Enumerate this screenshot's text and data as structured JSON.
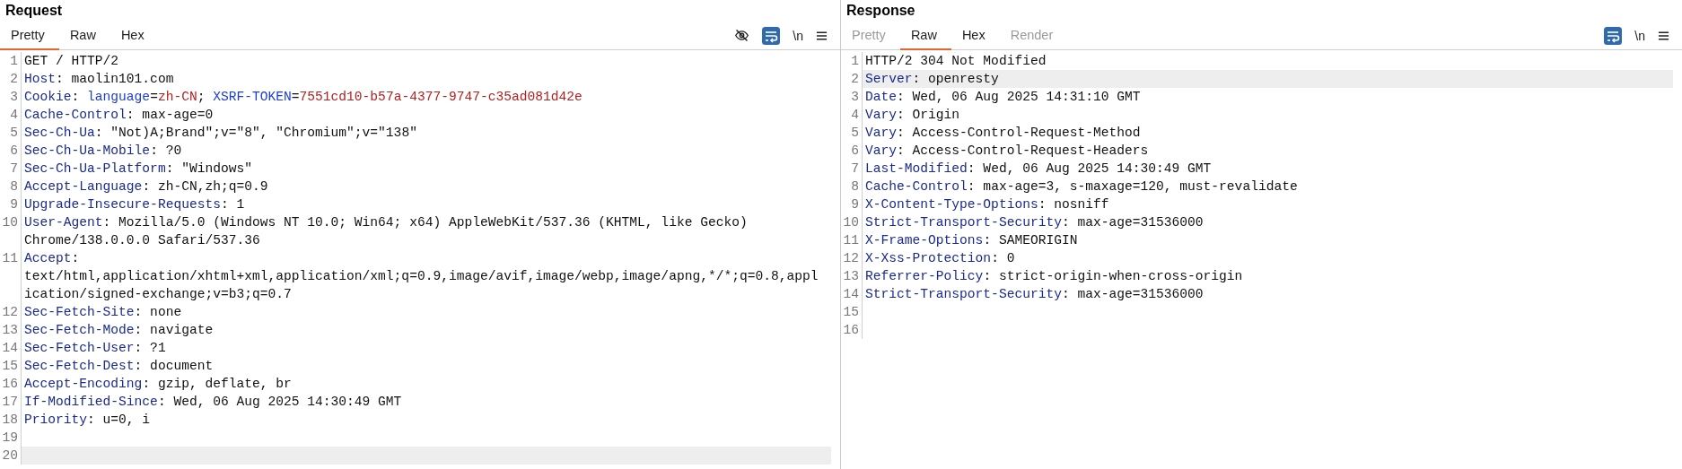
{
  "panes": [
    {
      "title": "Request",
      "tabs": [
        {
          "label": "Pretty",
          "selected": true,
          "disabled": false
        },
        {
          "label": "Raw",
          "selected": false,
          "disabled": false
        },
        {
          "label": "Hex",
          "selected": false,
          "disabled": false
        }
      ],
      "toolbar": [
        {
          "kind": "hide"
        },
        {
          "kind": "wrap",
          "on": true
        },
        {
          "kind": "newline",
          "label": "\\n"
        },
        {
          "kind": "menu"
        }
      ],
      "lines": [
        {
          "n": "1",
          "highlighted": false,
          "parts": [
            {
              "kind": "plain",
              "text": "GET / HTTP/2"
            }
          ]
        },
        {
          "n": "2",
          "highlighted": false,
          "parts": [
            {
              "kind": "key",
              "text": "Host"
            },
            {
              "kind": "plain",
              "text": ": maolin101.com"
            }
          ]
        },
        {
          "n": "3",
          "highlighted": false,
          "parts": [
            {
              "kind": "key",
              "text": "Cookie"
            },
            {
              "kind": "plain",
              "text": ": "
            },
            {
              "kind": "cookie_name",
              "text": "language"
            },
            {
              "kind": "plain",
              "text": "="
            },
            {
              "kind": "cookie_value",
              "text": "zh-CN"
            },
            {
              "kind": "plain",
              "text": "; "
            },
            {
              "kind": "cookie_name",
              "text": "XSRF-TOKEN"
            },
            {
              "kind": "plain",
              "text": "="
            },
            {
              "kind": "cookie_value",
              "text": "7551cd10-b57a-4377-9747-c35ad081d42e"
            }
          ]
        },
        {
          "n": "4",
          "highlighted": false,
          "parts": [
            {
              "kind": "key",
              "text": "Cache-Control"
            },
            {
              "kind": "plain",
              "text": ": max-age=0"
            }
          ]
        },
        {
          "n": "5",
          "highlighted": false,
          "parts": [
            {
              "kind": "key",
              "text": "Sec-Ch-Ua"
            },
            {
              "kind": "plain",
              "text": ": \"Not)A;Brand\";v=\"8\", \"Chromium\";v=\"138\""
            }
          ]
        },
        {
          "n": "6",
          "highlighted": false,
          "parts": [
            {
              "kind": "key",
              "text": "Sec-Ch-Ua-Mobile"
            },
            {
              "kind": "plain",
              "text": ": ?0"
            }
          ]
        },
        {
          "n": "7",
          "highlighted": false,
          "parts": [
            {
              "kind": "key",
              "text": "Sec-Ch-Ua-Platform"
            },
            {
              "kind": "plain",
              "text": ": \"Windows\""
            }
          ]
        },
        {
          "n": "8",
          "highlighted": false,
          "parts": [
            {
              "kind": "key",
              "text": "Accept-Language"
            },
            {
              "kind": "plain",
              "text": ": zh-CN,zh;q=0.9"
            }
          ]
        },
        {
          "n": "9",
          "highlighted": false,
          "parts": [
            {
              "kind": "key",
              "text": "Upgrade-Insecure-Requests"
            },
            {
              "kind": "plain",
              "text": ": 1"
            }
          ]
        },
        {
          "n": "10",
          "highlighted": false,
          "parts": [
            {
              "kind": "key",
              "text": "User-Agent"
            },
            {
              "kind": "plain",
              "text": ": Mozilla/5.0 (Windows NT 10.0; Win64; x64) AppleWebKit/537.36 (KHTML, like Gecko) Chrome/138.0.0.0 Safari/537.36"
            }
          ]
        },
        {
          "n": "11",
          "highlighted": false,
          "parts": [
            {
              "kind": "key",
              "text": "Accept"
            },
            {
              "kind": "plain",
              "text": ": text/html,application/xhtml+xml,application/xml;q=0.9,image/avif,image/webp,image/apng,*/*;q=0.8,application/signed-exchange;v=b3;q=0.7"
            }
          ]
        },
        {
          "n": "12",
          "highlighted": false,
          "parts": [
            {
              "kind": "key",
              "text": "Sec-Fetch-Site"
            },
            {
              "kind": "plain",
              "text": ": none"
            }
          ]
        },
        {
          "n": "13",
          "highlighted": false,
          "parts": [
            {
              "kind": "key",
              "text": "Sec-Fetch-Mode"
            },
            {
              "kind": "plain",
              "text": ": navigate"
            }
          ]
        },
        {
          "n": "14",
          "highlighted": false,
          "parts": [
            {
              "kind": "key",
              "text": "Sec-Fetch-User"
            },
            {
              "kind": "plain",
              "text": ": ?1"
            }
          ]
        },
        {
          "n": "15",
          "highlighted": false,
          "parts": [
            {
              "kind": "key",
              "text": "Sec-Fetch-Dest"
            },
            {
              "kind": "plain",
              "text": ": document"
            }
          ]
        },
        {
          "n": "16",
          "highlighted": false,
          "parts": [
            {
              "kind": "key",
              "text": "Accept-Encoding"
            },
            {
              "kind": "plain",
              "text": ": gzip, deflate, br"
            }
          ]
        },
        {
          "n": "17",
          "highlighted": false,
          "parts": [
            {
              "kind": "key",
              "text": "If-Modified-Since"
            },
            {
              "kind": "plain",
              "text": ": Wed, 06 Aug 2025 14:30:49 GMT"
            }
          ]
        },
        {
          "n": "18",
          "highlighted": false,
          "parts": [
            {
              "kind": "key",
              "text": "Priority"
            },
            {
              "kind": "plain",
              "text": ": u=0, i"
            }
          ]
        },
        {
          "n": "19",
          "highlighted": false
        },
        {
          "n": "20",
          "highlighted": true
        }
      ]
    },
    {
      "title": "Response",
      "tabs": [
        {
          "label": "Pretty",
          "selected": false,
          "disabled": true
        },
        {
          "label": "Raw",
          "selected": true,
          "disabled": false
        },
        {
          "label": "Hex",
          "selected": false,
          "disabled": false
        },
        {
          "label": "Render",
          "selected": false,
          "disabled": true
        }
      ],
      "toolbar": [
        {
          "kind": "wrap",
          "on": true
        },
        {
          "kind": "newline",
          "label": "\\n"
        },
        {
          "kind": "menu"
        }
      ],
      "lines": [
        {
          "n": "1",
          "highlighted": false,
          "parts": [
            {
              "kind": "plain",
              "text": "HTTP/2 304 Not Modified"
            }
          ]
        },
        {
          "n": "2",
          "highlighted": true,
          "parts": [
            {
              "kind": "key",
              "text": "Server"
            },
            {
              "kind": "plain",
              "text": ": openresty"
            }
          ]
        },
        {
          "n": "3",
          "highlighted": false,
          "parts": [
            {
              "kind": "key",
              "text": "Date"
            },
            {
              "kind": "plain",
              "text": ": Wed, 06 Aug 2025 14:31:10 GMT"
            }
          ]
        },
        {
          "n": "4",
          "highlighted": false,
          "parts": [
            {
              "kind": "key",
              "text": "Vary"
            },
            {
              "kind": "plain",
              "text": ": Origin"
            }
          ]
        },
        {
          "n": "5",
          "highlighted": false,
          "parts": [
            {
              "kind": "key",
              "text": "Vary"
            },
            {
              "kind": "plain",
              "text": ": Access-Control-Request-Method"
            }
          ]
        },
        {
          "n": "6",
          "highlighted": false,
          "parts": [
            {
              "kind": "key",
              "text": "Vary"
            },
            {
              "kind": "plain",
              "text": ": Access-Control-Request-Headers"
            }
          ]
        },
        {
          "n": "7",
          "highlighted": false,
          "parts": [
            {
              "kind": "key",
              "text": "Last-Modified"
            },
            {
              "kind": "plain",
              "text": ": Wed, 06 Aug 2025 14:30:49 GMT"
            }
          ]
        },
        {
          "n": "8",
          "highlighted": false,
          "parts": [
            {
              "kind": "key",
              "text": "Cache-Control"
            },
            {
              "kind": "plain",
              "text": ": max-age=3, s-maxage=120, must-revalidate"
            }
          ]
        },
        {
          "n": "9",
          "highlighted": false,
          "parts": [
            {
              "kind": "key",
              "text": "X-Content-Type-Options"
            },
            {
              "kind": "plain",
              "text": ": nosniff"
            }
          ]
        },
        {
          "n": "10",
          "highlighted": false,
          "parts": [
            {
              "kind": "key",
              "text": "Strict-Transport-Security"
            },
            {
              "kind": "plain",
              "text": ": max-age=31536000"
            }
          ]
        },
        {
          "n": "11",
          "highlighted": false,
          "parts": [
            {
              "kind": "key",
              "text": "X-Frame-Options"
            },
            {
              "kind": "plain",
              "text": ": SAMEORIGIN"
            }
          ]
        },
        {
          "n": "12",
          "highlighted": false,
          "parts": [
            {
              "kind": "key",
              "text": "X-Xss-Protection"
            },
            {
              "kind": "plain",
              "text": ": 0"
            }
          ]
        },
        {
          "n": "13",
          "highlighted": false,
          "parts": [
            {
              "kind": "key",
              "text": "Referrer-Policy"
            },
            {
              "kind": "plain",
              "text": ": strict-origin-when-cross-origin"
            }
          ]
        },
        {
          "n": "14",
          "highlighted": false,
          "parts": [
            {
              "kind": "key",
              "text": "Strict-Transport-Security"
            },
            {
              "kind": "plain",
              "text": ": max-age=31536000"
            }
          ]
        },
        {
          "n": "15",
          "highlighted": false
        },
        {
          "n": "16",
          "highlighted": false
        }
      ]
    }
  ]
}
